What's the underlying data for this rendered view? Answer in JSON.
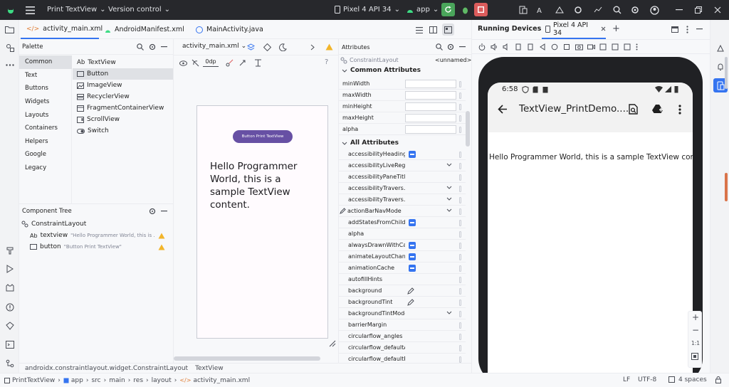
{
  "topbar": {
    "project": "Print TextView",
    "vcs": "Version control",
    "device": "Pixel 4 API 34",
    "run_config": "app"
  },
  "tabs": [
    {
      "label": "activity_main.xml"
    },
    {
      "label": "AndroidManifest.xml"
    },
    {
      "label": "MainActivity.java"
    }
  ],
  "palette": {
    "title": "Palette",
    "categories": [
      "Common",
      "Text",
      "Buttons",
      "Widgets",
      "Layouts",
      "Containers",
      "Helpers",
      "Google",
      "Legacy"
    ],
    "items": [
      {
        "icon": "Ab",
        "label": "TextView"
      },
      {
        "icon": "btn",
        "label": "Button"
      },
      {
        "icon": "img",
        "label": "ImageView"
      },
      {
        "icon": "list",
        "label": "RecyclerView"
      },
      {
        "icon": "frag",
        "label": "FragmentContainerView"
      },
      {
        "icon": "scroll",
        "label": "ScrollView"
      },
      {
        "icon": "switch",
        "label": "Switch"
      }
    ]
  },
  "tree": {
    "title": "Component Tree",
    "root": "ConstraintLayout",
    "children": [
      {
        "icon": "Ab",
        "name": "textview",
        "desc": "\"Hello Programmer World, this is ..."
      },
      {
        "icon": "btn",
        "name": "button",
        "desc": "\"Button Print TextView\""
      }
    ]
  },
  "design": {
    "file_label": "activity_main.xml",
    "margin": "0dp",
    "preview_button": "Button Print TextView",
    "preview_text": "Hello Programmer World, this is a sample TextView content."
  },
  "attributes": {
    "title": "Attributes",
    "class": "ConstraintLayout",
    "id": "<unnamed>",
    "common_title": "Common Attributes",
    "common": [
      "minWidth",
      "maxWidth",
      "minHeight",
      "maxHeight",
      "alpha"
    ],
    "all_title": "All Attributes",
    "all": [
      {
        "name": "accessibilityHeading",
        "ctl": "blue"
      },
      {
        "name": "accessibilityLiveRegi...",
        "ctl": "dropdown"
      },
      {
        "name": "accessibilityPaneTitle",
        "ctl": "none"
      },
      {
        "name": "accessibilityTravers...",
        "ctl": "dropdown"
      },
      {
        "name": "accessibilityTravers...",
        "ctl": "dropdown"
      },
      {
        "name": "actionBarNavMode",
        "ctl": "dropdown2"
      },
      {
        "name": "addStatesFromChild...",
        "ctl": "blue"
      },
      {
        "name": "alpha",
        "ctl": "none"
      },
      {
        "name": "alwaysDrawnWithCa...",
        "ctl": "blue"
      },
      {
        "name": "animateLayoutChan...",
        "ctl": "blue"
      },
      {
        "name": "animationCache",
        "ctl": "blue"
      },
      {
        "name": "autofillHints",
        "ctl": "none"
      },
      {
        "name": "background",
        "ctl": "pen"
      },
      {
        "name": "backgroundTint",
        "ctl": "pen"
      },
      {
        "name": "backgroundTintMode",
        "ctl": "dropdown2"
      },
      {
        "name": "barrierMargin",
        "ctl": "none"
      },
      {
        "name": "circularflow_angles",
        "ctl": "none"
      },
      {
        "name": "circularflow_defaultA...",
        "ctl": "none"
      },
      {
        "name": "circularflow_defaultR...",
        "ctl": "none"
      }
    ]
  },
  "running": {
    "title": "Running Devices",
    "tab": "Pixel 4 API 34",
    "time": "6:58",
    "app_title": "TextView_PrintDemo....",
    "content": "Hello Programmer World, this is a sample TextView content.",
    "zoom": "1:1"
  },
  "breadcrumb_bottom": {
    "path": "androidx.constraintlayout.widget.ConstraintLayout",
    "leaf": "TextView"
  },
  "status": {
    "crumbs": [
      "PrintTextView",
      "app",
      "src",
      "main",
      "res",
      "layout",
      "activity_main.xml"
    ],
    "lf": "LF",
    "enc": "UTF-8",
    "indent": "4 spaces"
  }
}
